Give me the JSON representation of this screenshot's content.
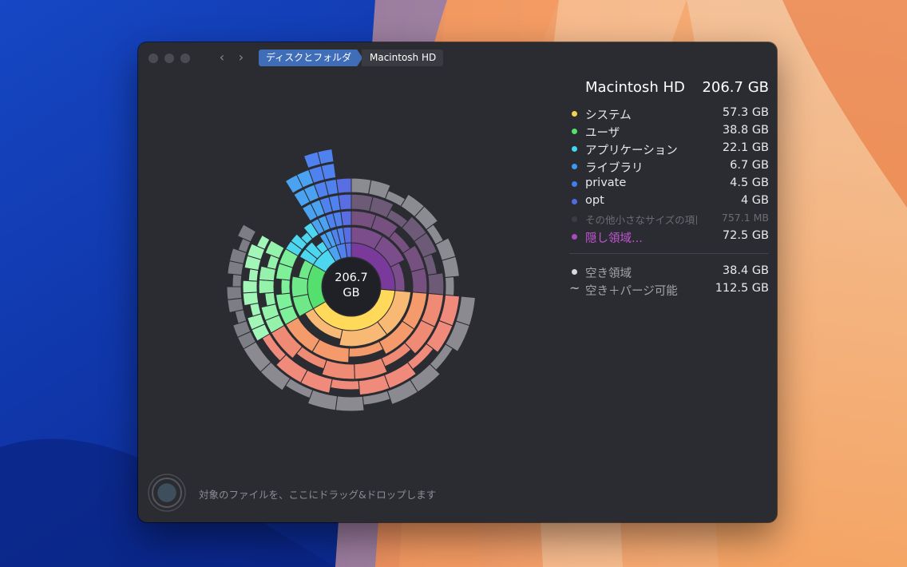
{
  "breadcrumb": {
    "parent": "ディスクとフォルダ",
    "current": "Macintosh HD"
  },
  "disk": {
    "name": "Macintosh HD",
    "total": "206.7 GB"
  },
  "center": {
    "value": "206.7",
    "unit": "GB"
  },
  "legend": [
    {
      "label": "システム",
      "value": "57.3 GB",
      "color": "#f4d24e"
    },
    {
      "label": "ユーザ",
      "value": "38.8 GB",
      "color": "#4fe36a"
    },
    {
      "label": "アプリケーション",
      "value": "22.1 GB",
      "color": "#3ed8f0"
    },
    {
      "label": "ライブラリ",
      "value": "6.7 GB",
      "color": "#3b9bf2"
    },
    {
      "label": "private",
      "value": "4.5 GB",
      "color": "#3f7df0"
    },
    {
      "label": "opt",
      "value": "4    GB",
      "color": "#4f6ce6"
    },
    {
      "label": "その他小さなサイズの項目",
      "value": "757.1  MB",
      "color": "#3b3c44"
    },
    {
      "label": "隠し領域...",
      "value": "72.5 GB",
      "color": "#a64bc0"
    }
  ],
  "free": [
    {
      "label": "空き領域",
      "value": "38.4 GB",
      "symbol": "●"
    },
    {
      "label": "空き＋パージ可能",
      "value": "112.5 GB",
      "symbol": "~"
    }
  ],
  "drop_hint": "対象のファイルを、ここにドラッグ&ドロップします",
  "icons": {
    "back": "chevron-left-icon",
    "forward": "chevron-right-icon",
    "drop": "target-circle-icon"
  }
}
